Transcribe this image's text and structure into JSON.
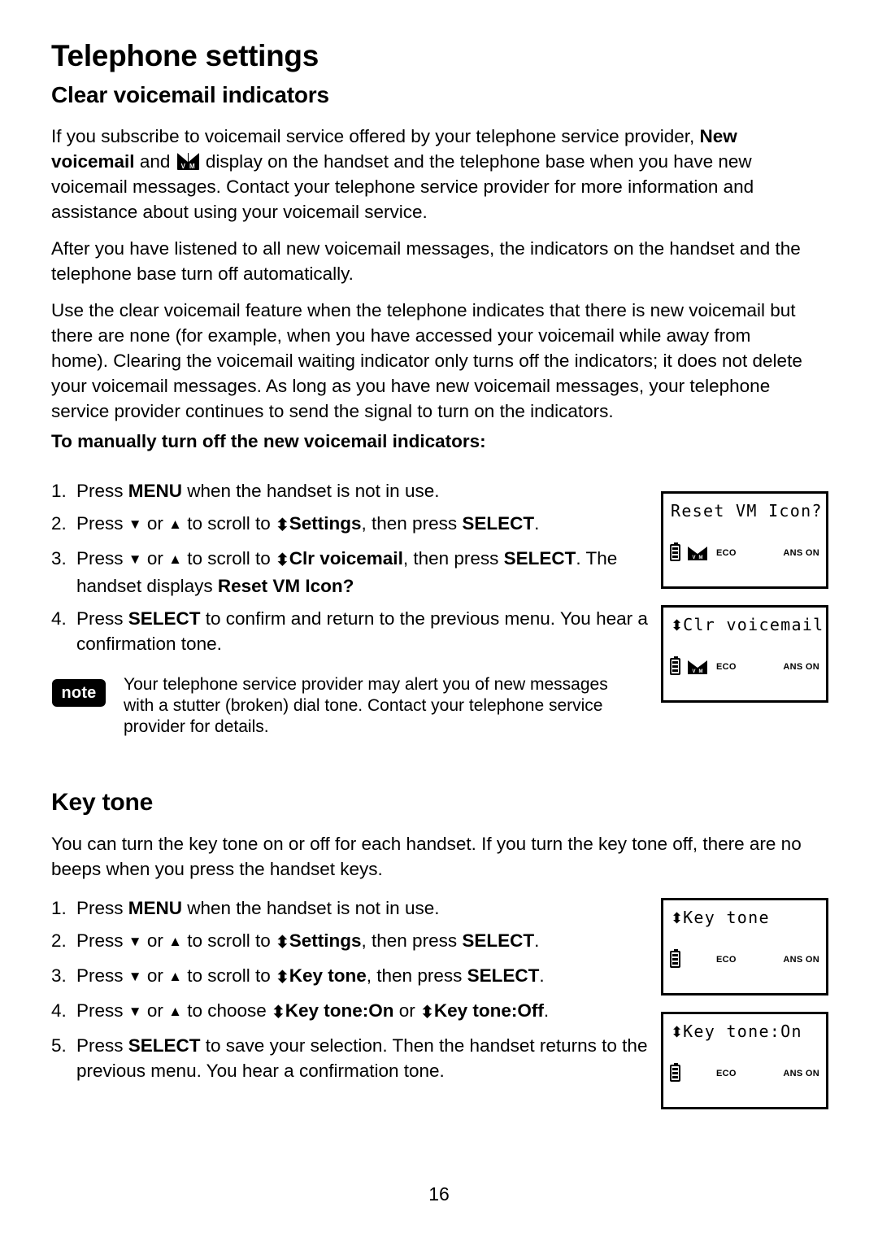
{
  "document": {
    "chapter_title": "Telephone settings",
    "page_number": "16"
  },
  "section_voicemail": {
    "heading": "Clear voicemail indicators",
    "paragraph_1_a": "If you subscribe to voicemail service offered by your telephone service provider, ",
    "paragraph_1_bold": "New voicemail",
    "paragraph_1_b": " and ",
    "paragraph_1_c": " display on the handset and the telephone base when you have new voicemail messages. Contact your telephone service provider for more information and assistance about using your voicemail service.",
    "paragraph_2": "After you have listened to all new voicemail messages, the indicators on the handset and the telephone base turn off automatically.",
    "paragraph_3": "Use the clear voicemail feature when the telephone indicates that there is new voicemail but there are none (for example, when you have accessed your voicemail while away from home). Clearing the voicemail waiting indicator only turns off the indicators; it does not delete your voicemail messages. As long as you have new voicemail messages, your telephone service provider continues to send the signal to turn on the indicators.",
    "procedure_heading": "To manually turn off the new voicemail indicators:",
    "steps": [
      {
        "number": "1.",
        "parts": [
          {
            "t": "Press ",
            "b": false
          },
          {
            "t": "MENU",
            "b": true
          },
          {
            "t": " when the handset is not in use.",
            "b": false
          }
        ]
      },
      {
        "number": "2.",
        "parts": [
          {
            "t": "Press ",
            "b": false
          },
          {
            "t": "▼",
            "b": false,
            "cls": "arrow"
          },
          {
            "t": " or ",
            "b": false
          },
          {
            "t": "▲",
            "b": false,
            "cls": "arrow"
          },
          {
            "t": " to scroll to ",
            "b": false
          },
          {
            "t": "⬍",
            "b": true,
            "cls": "updown"
          },
          {
            "t": "Settings",
            "b": true
          },
          {
            "t": ", then press ",
            "b": false
          },
          {
            "t": "SELECT",
            "b": true
          },
          {
            "t": ".",
            "b": false
          }
        ]
      },
      {
        "number": "3.",
        "parts": [
          {
            "t": "Press ",
            "b": false
          },
          {
            "t": "▼",
            "b": false,
            "cls": "arrow"
          },
          {
            "t": " or ",
            "b": false
          },
          {
            "t": "▲",
            "b": false,
            "cls": "arrow"
          },
          {
            "t": " to scroll to ",
            "b": false
          },
          {
            "t": "⬍",
            "b": true,
            "cls": "updown"
          },
          {
            "t": "Clr voicemail",
            "b": true
          },
          {
            "t": ", then press ",
            "b": false
          },
          {
            "t": "SELECT",
            "b": true
          },
          {
            "t": ". The handset displays ",
            "b": false
          },
          {
            "t": "Reset VM Icon?",
            "b": true
          }
        ]
      },
      {
        "number": "4.",
        "parts": [
          {
            "t": "Press ",
            "b": false
          },
          {
            "t": "SELECT",
            "b": true
          },
          {
            "t": " to confirm and return to the previous menu. You hear a confirmation tone.",
            "b": false
          }
        ]
      }
    ],
    "note": {
      "badge": "note",
      "text": "Your telephone service provider may alert you of new messages with a stutter (broken) dial tone. Contact your telephone service provider for details."
    },
    "screens": [
      {
        "line": "Reset VM Icon?",
        "prefix_updown": false,
        "has_envelope": true,
        "eco": "ECO",
        "ans": "ANS ON"
      },
      {
        "line": "Clr voicemail",
        "prefix_updown": true,
        "has_envelope": true,
        "eco": "ECO",
        "ans": "ANS ON"
      }
    ]
  },
  "section_keytone": {
    "heading": "Key tone",
    "paragraph_1": "You can turn the key tone on or off for each handset. If you turn the key tone off, there are no beeps when you press the handset keys.",
    "steps": [
      {
        "number": "1.",
        "parts": [
          {
            "t": "Press ",
            "b": false
          },
          {
            "t": "MENU",
            "b": true
          },
          {
            "t": " when the handset is not in use.",
            "b": false
          }
        ]
      },
      {
        "number": "2.",
        "parts": [
          {
            "t": "Press ",
            "b": false
          },
          {
            "t": "▼",
            "b": false,
            "cls": "arrow"
          },
          {
            "t": " or ",
            "b": false
          },
          {
            "t": "▲",
            "b": false,
            "cls": "arrow"
          },
          {
            "t": " to scroll to ",
            "b": false
          },
          {
            "t": "⬍",
            "b": true,
            "cls": "updown"
          },
          {
            "t": "Settings",
            "b": true
          },
          {
            "t": ", then press ",
            "b": false
          },
          {
            "t": "SELECT",
            "b": true
          },
          {
            "t": ".",
            "b": false
          }
        ]
      },
      {
        "number": "3.",
        "parts": [
          {
            "t": "Press ",
            "b": false
          },
          {
            "t": "▼",
            "b": false,
            "cls": "arrow"
          },
          {
            "t": " or ",
            "b": false
          },
          {
            "t": "▲",
            "b": false,
            "cls": "arrow"
          },
          {
            "t": " to scroll to ",
            "b": false
          },
          {
            "t": "⬍",
            "b": true,
            "cls": "updown"
          },
          {
            "t": "Key tone",
            "b": true
          },
          {
            "t": ", then press ",
            "b": false
          },
          {
            "t": "SELECT",
            "b": true
          },
          {
            "t": ".",
            "b": false
          }
        ]
      },
      {
        "number": "4.",
        "parts": [
          {
            "t": "Press ",
            "b": false
          },
          {
            "t": "▼",
            "b": false,
            "cls": "arrow"
          },
          {
            "t": " or ",
            "b": false
          },
          {
            "t": "▲",
            "b": false,
            "cls": "arrow"
          },
          {
            "t": " to choose ",
            "b": false
          },
          {
            "t": "⬍",
            "b": true,
            "cls": "updown"
          },
          {
            "t": "Key tone:On",
            "b": true
          },
          {
            "t": " or ",
            "b": false
          },
          {
            "t": "⬍",
            "b": true,
            "cls": "updown"
          },
          {
            "t": "Key tone:Off",
            "b": true
          },
          {
            "t": ".",
            "b": false
          }
        ]
      },
      {
        "number": "5.",
        "parts": [
          {
            "t": "Press ",
            "b": false
          },
          {
            "t": "SELECT",
            "b": true
          },
          {
            "t": " to save your selection. Then the handset returns to the previous menu. You hear a confirmation tone.",
            "b": false
          }
        ]
      }
    ],
    "screens": [
      {
        "line": "Key tone",
        "prefix_updown": true,
        "has_envelope": false,
        "eco": "ECO",
        "ans": "ANS ON"
      },
      {
        "line": "Key tone:On",
        "prefix_updown": true,
        "has_envelope": false,
        "eco": "ECO",
        "ans": "ANS ON"
      }
    ]
  },
  "icons": {
    "voicemail_envelope": "envelope-vm-icon",
    "battery": "battery-icon",
    "scroll_up": "triangle-up-icon",
    "scroll_down": "triangle-down-icon",
    "updown": "up-down-arrow-icon"
  },
  "colors": {
    "ink": "#000000",
    "paper": "#ffffff"
  }
}
